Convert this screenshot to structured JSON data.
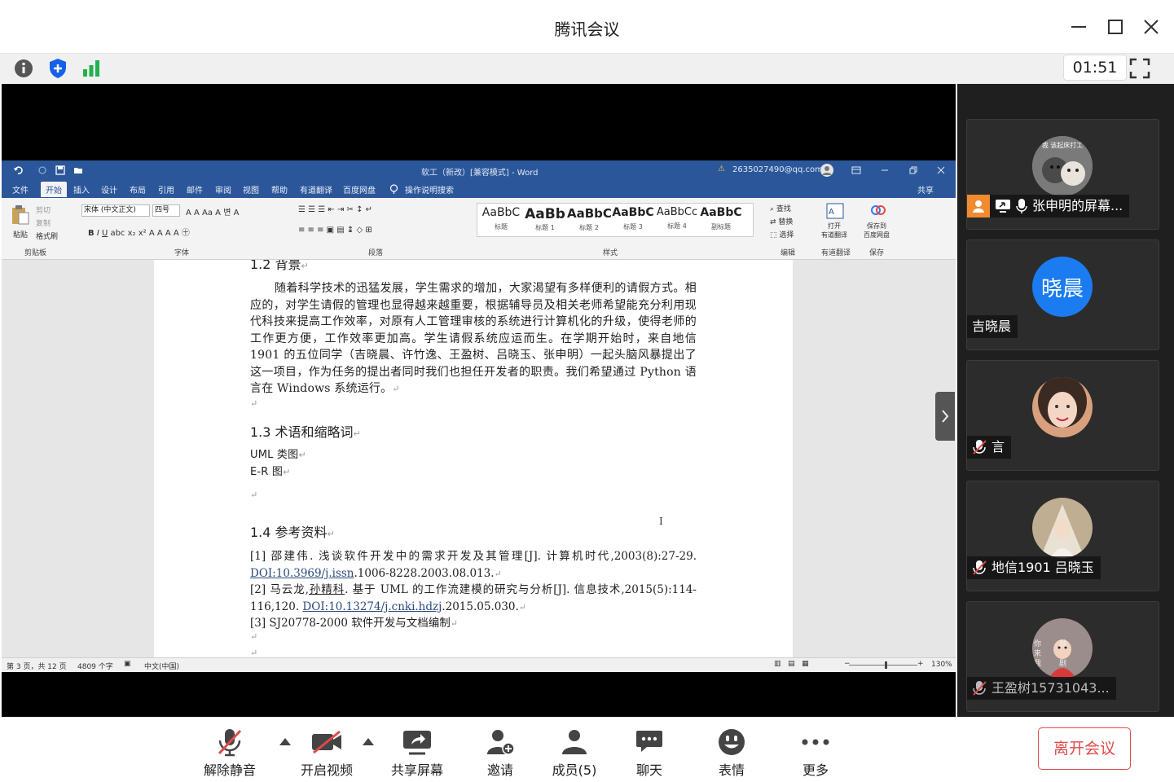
{
  "app": {
    "title": "腾讯会议",
    "timer": "01:51"
  },
  "word": {
    "doc_title": "软工（新改）[兼容模式] - Word",
    "warning": "⚠",
    "account": "2635027490@qq.com",
    "tabs": [
      "文件",
      "开始",
      "插入",
      "设计",
      "布局",
      "引用",
      "邮件",
      "审阅",
      "视图",
      "帮助",
      "有道翻译",
      "百度网盘"
    ],
    "tellme": "操作说明搜索",
    "share": "共享",
    "ribbon": {
      "paste": "粘贴",
      "cut": "剪切",
      "copy": "复制",
      "painter": "格式刷",
      "clipboard": "剪贴板",
      "font_name": "宋体 (中文正文)",
      "font_size": "四号",
      "font_group": "字体",
      "para_group": "段落",
      "style_group": "样式",
      "edit_group": "编辑",
      "find": "查找",
      "replace": "替换",
      "select": "选择",
      "youdao": "打开\n有道翻译",
      "youdao_group": "有道翻译",
      "baidu": "保存到\n百度网盘",
      "save_group": "保存",
      "styles": [
        {
          "sample": "AaBbC",
          "name": "标题"
        },
        {
          "sample": "AaBb",
          "name": "标题 1"
        },
        {
          "sample": "AaBbC",
          "name": "标题 2"
        },
        {
          "sample": "AaBbC",
          "name": "标题 3"
        },
        {
          "sample": "AaBbCc",
          "name": "标题 4"
        },
        {
          "sample": "AaBbC",
          "name": "副标题"
        }
      ]
    },
    "doc": {
      "h12": "1.2 背景",
      "bg_para": "随着科学技术的迅猛发展，学生需求的增加，大家渴望有多样便利的请假方式。相应的，对学生请假的管理也显得越来越重要，根据辅导员及相关老师希望能充分利用现代科技来提高工作效率，对原有人工管理审核的系统进行计算机化的升级，使得老师的工作更方便，工作效率更加高。学生请假系统应运而生。在学期开始时，来自地信 1901 的五位同学（吉晓晨、许竹逸、王盈树、吕晓玉、张申明）一起头脑风暴提出了这一项目，作为任务的提出者同时我们也担任开发者的职责。我们希望通过 Python 语言在 Windows 系统运行。",
      "h13": "1.3 术语和缩略词",
      "term1": "UML 类图",
      "term2": "E-R 图",
      "h14": "1.4 参考资料",
      "ref1_a": "[1]  邵建伟. 浅谈软件开发中的需求开发及其管理[J]. 计算机时代,2003(8):27-29. ",
      "ref1_doi": "DOI:10.3969/j.issn",
      "ref1_b": ".1006-8228.2003.08.013.",
      "ref2_a": "[2]  马云龙,",
      "ref2_author": "孙精科",
      "ref2_b": ". 基于 UML 的工作流建模的研究与分析[J]. 信息技术,2015(5):114-116,120. ",
      "ref2_doi": "DOI:10.13274/j.cnki.hdzj",
      "ref2_c": ".2015.05.030.",
      "ref3": "[3]  SJ20778-2000 软件开发与文档编制"
    },
    "status": {
      "page": "第 3 页，共 12 页",
      "words": "4809 个字",
      "lang": "中文(中国)",
      "zoom": "130%"
    }
  },
  "participants": [
    {
      "name": "张申明的屏幕...",
      "avatar_text": "我 该起床打工",
      "mic": "on",
      "avatar_color": "#8a8a8a"
    },
    {
      "name": "吉晓晨",
      "avatar_text": "晓晨",
      "mic": "none",
      "avatar_color": "#1a7cf0"
    },
    {
      "name": "言",
      "avatar_text": "",
      "mic": "muted",
      "avatar_color": "#c98d6a"
    },
    {
      "name": "地信1901 吕晓玉",
      "avatar_text": "",
      "mic": "muted",
      "avatar_color": "#cbb89c"
    },
    {
      "name": "王盈树15731043...",
      "avatar_text": "你越来 我剧你",
      "mic": "muted",
      "avatar_color": "#8f7f7f"
    }
  ],
  "controls": [
    {
      "label": "解除静音",
      "icon": "mic-muted-icon"
    },
    {
      "label": "开启视频",
      "icon": "camera-off-icon"
    },
    {
      "label": "共享屏幕",
      "icon": "share-screen-icon"
    },
    {
      "label": "邀请",
      "icon": "invite-icon"
    },
    {
      "label": "成员(5)",
      "icon": "members-icon"
    },
    {
      "label": "聊天",
      "icon": "chat-icon"
    },
    {
      "label": "表情",
      "icon": "emoji-icon"
    },
    {
      "label": "更多",
      "icon": "more-icon"
    }
  ],
  "leave": "离开会议",
  "colors": {
    "word_blue": "#2b579a",
    "leave_red": "#e04a4a",
    "avatar_blue": "#1a7cf0",
    "signal_green": "#22b14c",
    "shield_blue": "#1560e8"
  }
}
